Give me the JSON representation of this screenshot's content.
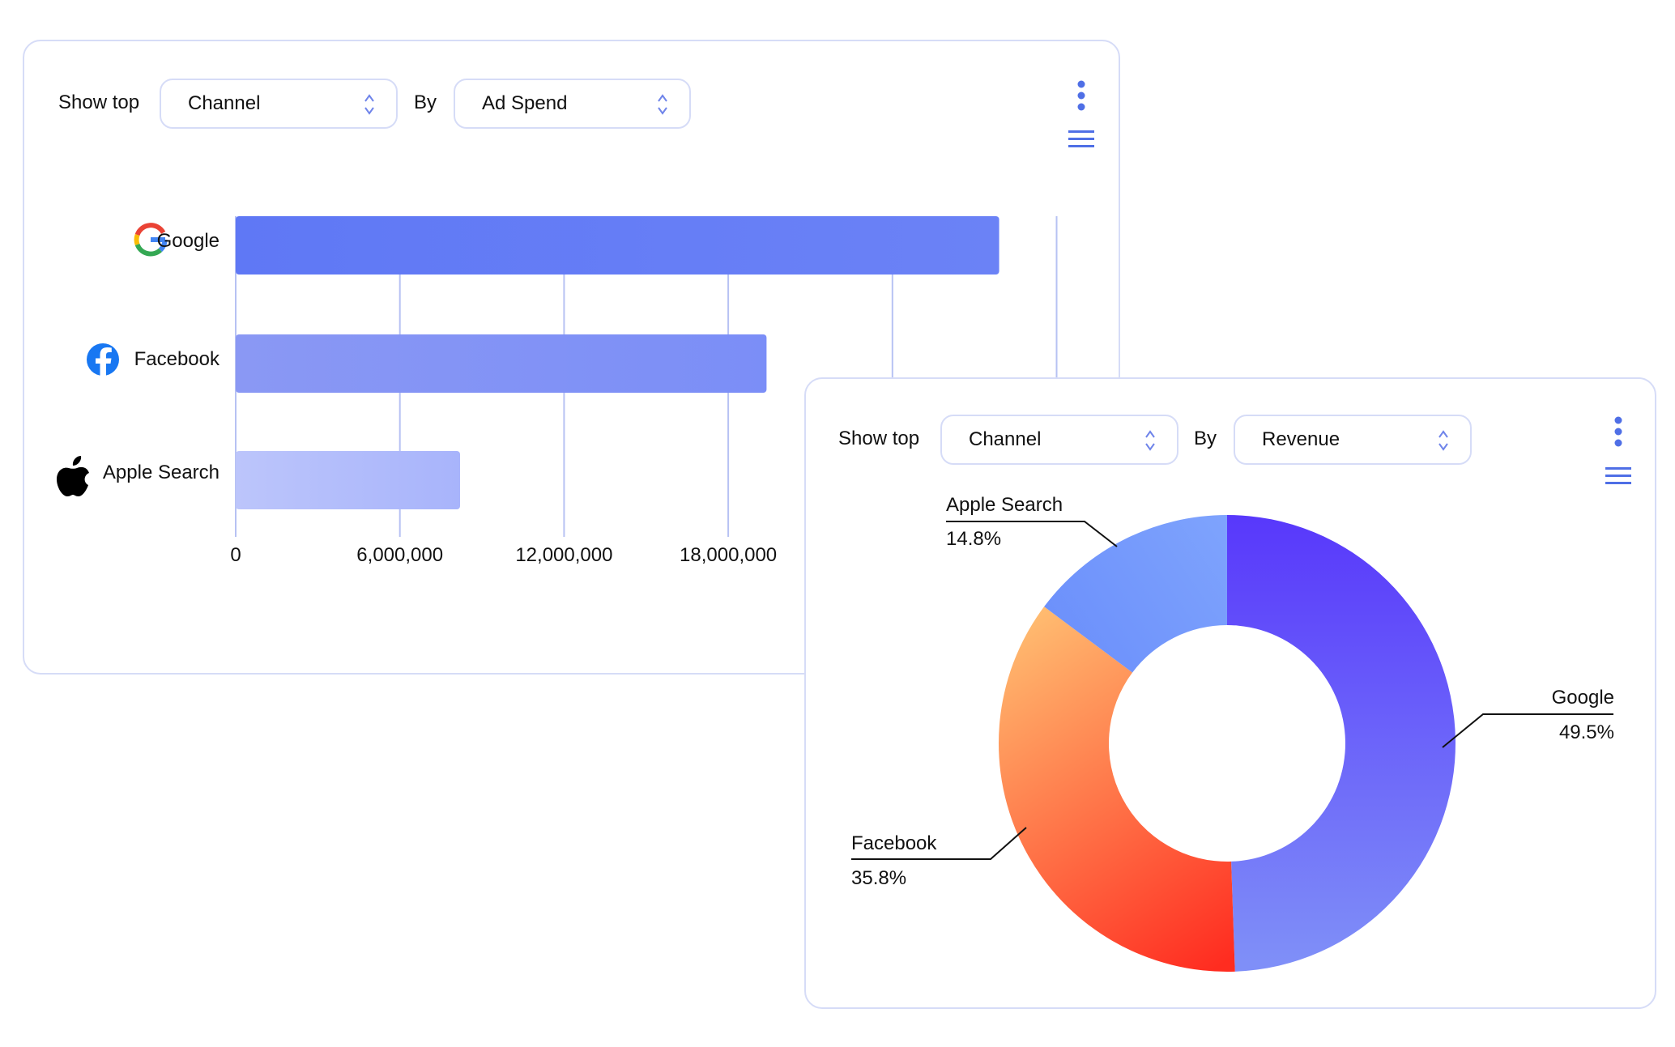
{
  "bar_card": {
    "show_top_label": "Show top",
    "dimension_select": "Channel",
    "by_label": "By",
    "metric_select": "Ad Spend"
  },
  "pie_card": {
    "show_top_label": "Show top",
    "dimension_select": "Channel",
    "by_label": "By",
    "metric_select": "Revenue"
  },
  "colors": {
    "accent": "#4f6fe6",
    "border": "#d6dcf7",
    "grid": "#b7c2f3"
  },
  "chart_data": [
    {
      "type": "bar",
      "orientation": "horizontal",
      "categories": [
        "Google",
        "Facebook",
        "Apple Search"
      ],
      "category_icons": [
        "google-logo-icon",
        "facebook-logo-icon",
        "apple-logo-icon"
      ],
      "values": [
        27900000,
        19400000,
        8200000
      ],
      "xlim": [
        0,
        29600000
      ],
      "xticks": [
        0,
        6000000,
        12000000,
        18000000
      ],
      "tick_labels": [
        "0",
        "6,000,000",
        "12,000,000",
        "18,000,000"
      ],
      "grid": true,
      "bar_colors": [
        "#627bf5",
        "#8494f5",
        "#aab6fb"
      ]
    },
    {
      "type": "pie",
      "variant": "donut",
      "slices": [
        {
          "label": "Google",
          "value": 49.5,
          "display": "49.5%",
          "color_from": "#5838fb",
          "color_to": "#7f8ff8"
        },
        {
          "label": "Facebook",
          "value": 35.8,
          "display": "35.8%",
          "color_from": "#ffbf72",
          "color_to": "#ff2c20"
        },
        {
          "label": "Apple Search",
          "value": 14.8,
          "display": "14.8%",
          "color_from": "#6b8ffb",
          "color_to": "#7ea3fd"
        }
      ]
    }
  ]
}
